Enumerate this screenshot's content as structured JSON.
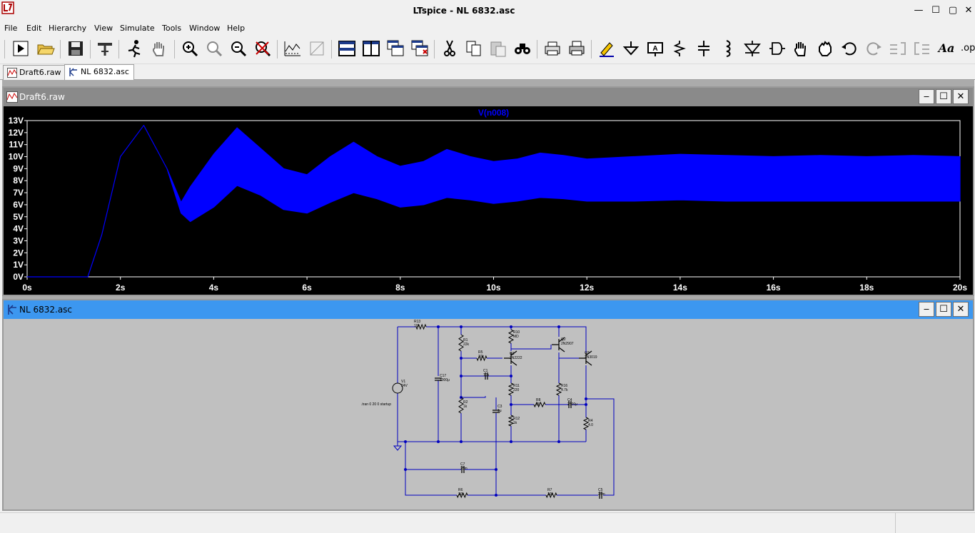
{
  "window": {
    "title": "LTspice - NL 6832.asc",
    "minimize": "—",
    "maximize": "☐",
    "close": "✕"
  },
  "menu": [
    "File",
    "Edit",
    "Hierarchy",
    "View",
    "Simulate",
    "Tools",
    "Window",
    "Help"
  ],
  "toolbar": {
    "buttons": [
      "run-icon",
      "open-icon",
      "save-icon",
      "control-panel-icon",
      "run-stop-icon",
      "pan-icon",
      "zoom-in-icon",
      "zoom-fit-icon",
      "zoom-out-icon",
      "zoom-cancel-icon",
      "autorange-icon",
      "grid-icon",
      "tile-horizontal-icon",
      "tile-vertical-icon",
      "cascade-icon",
      "close-all-icon",
      "cut-icon",
      "copy-icon",
      "paste-icon",
      "find-icon",
      "print-preview-icon",
      "print-icon",
      "draw-wire-icon",
      "ground-icon",
      "label-net-icon",
      "resistor-icon",
      "capacitor-icon",
      "inductor-icon",
      "diode-icon",
      "component-icon",
      "move-icon",
      "drag-icon",
      "undo-icon",
      "redo-icon",
      "rotate-icon",
      "mirror-icon",
      "text-icon",
      "spice-directive-icon"
    ],
    "text_label": "Aa",
    "op_label": ".op"
  },
  "tabs": [
    {
      "label": "Draft6.raw",
      "active": false
    },
    {
      "label": "NL 6832.asc",
      "active": true
    }
  ],
  "plot_window": {
    "title": "Draft6.raw",
    "trace_label": "V(n008)",
    "trace_color": "#0000ff"
  },
  "schematic_window": {
    "title": "NL 6832.asc"
  },
  "chart_data": {
    "type": "line",
    "title": "",
    "series": [
      {
        "name": "V(n008)",
        "color": "#0000ff"
      }
    ],
    "xlabel": "",
    "ylabel": "",
    "x_ticks": [
      "0s",
      "2s",
      "4s",
      "6s",
      "8s",
      "10s",
      "12s",
      "14s",
      "16s",
      "18s",
      "20s"
    ],
    "y_ticks": [
      "0V",
      "1V",
      "2V",
      "3V",
      "4V",
      "5V",
      "6V",
      "7V",
      "8V",
      "9V",
      "10V",
      "11V",
      "12V",
      "13V"
    ],
    "xlim": [
      0,
      20
    ],
    "ylim": [
      0,
      13
    ],
    "envelope": {
      "time_s": [
        0,
        1.3,
        1.6,
        2.0,
        2.5,
        3.0,
        3.3,
        3.5,
        4.0,
        4.5,
        5.0,
        5.5,
        6.0,
        6.5,
        7.0,
        7.5,
        8.0,
        8.5,
        9.0,
        9.5,
        10.0,
        10.5,
        11.0,
        11.5,
        12.0,
        13.0,
        14.0,
        15.0,
        16.0,
        17.0,
        18.0,
        19.0,
        20.0
      ],
      "upper_v": [
        0,
        0,
        3.5,
        10.0,
        12.6,
        9.0,
        6.2,
        7.5,
        10.2,
        12.4,
        10.7,
        9.0,
        8.5,
        10.0,
        11.2,
        10.0,
        9.2,
        9.6,
        10.6,
        10.0,
        9.6,
        9.8,
        10.3,
        10.1,
        9.8,
        10.0,
        10.2,
        10.1,
        10.0,
        10.1,
        10.0,
        10.1,
        10.0
      ],
      "lower_v": [
        0,
        0,
        3.5,
        10.0,
        12.6,
        9.0,
        5.3,
        4.6,
        5.8,
        7.6,
        6.8,
        5.6,
        5.3,
        6.2,
        7.0,
        6.5,
        5.8,
        6.0,
        6.6,
        6.4,
        6.1,
        6.3,
        6.6,
        6.5,
        6.3,
        6.3,
        6.4,
        6.3,
        6.3,
        6.3,
        6.3,
        6.3,
        6.3
      ]
    },
    "grid": false,
    "background": "#000000",
    "axis_color": "#ffffff"
  },
  "schematic": {
    "wire_color": "#0000c0",
    "parts": [
      {
        "ref": "R13",
        "value": "10k"
      },
      {
        "ref": "R1",
        "value": "22k"
      },
      {
        "ref": "R10",
        "value": "MD"
      },
      {
        "ref": "Q2",
        "value": "2N2907"
      },
      {
        "ref": "R5",
        "value": "10k"
      },
      {
        "ref": "Q1",
        "value": "2N2222"
      },
      {
        "ref": "Q3",
        "value": "2N3019"
      },
      {
        "ref": "C17",
        "value": "1000μ"
      },
      {
        "ref": "C1",
        "value": "10μ"
      },
      {
        "ref": "V1",
        "value": "24V"
      },
      {
        "ref": "R11",
        "value": "220"
      },
      {
        "ref": "R16",
        "value": "4.7k"
      },
      {
        "ref": "R2",
        "value": "1k"
      },
      {
        "ref": "C3",
        "value": "1μ"
      },
      {
        "ref": "R8",
        "value": "80"
      },
      {
        "ref": "C4",
        "value": "2500μ"
      },
      {
        "ref": "R12",
        "value": "1k"
      },
      {
        "ref": "R4",
        "value": "4.0"
      },
      {
        "ref": "C7",
        "value": "25m"
      },
      {
        "ref": "R6",
        "value": "10k"
      },
      {
        "ref": "R7",
        "value": "10k"
      },
      {
        "ref": "C5",
        "value": "25m"
      }
    ],
    "directive": ".tran 0 20 0 startup"
  }
}
